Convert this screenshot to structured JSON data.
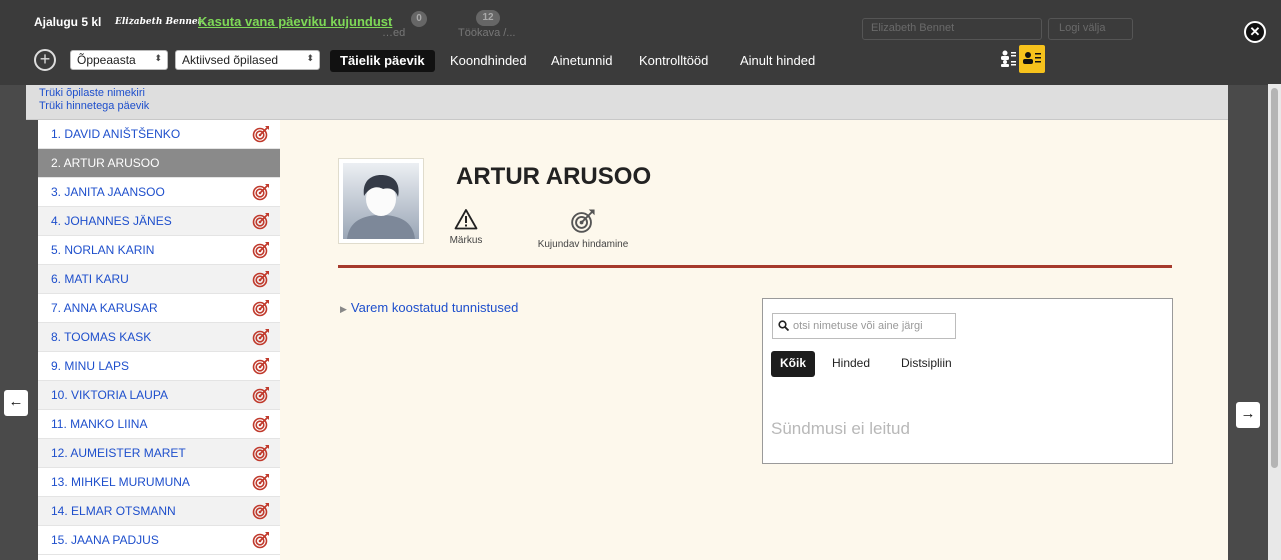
{
  "header": {
    "class_title": "Ajalugu 5 kl",
    "user_signature": "Elizabeth Bennet.",
    "old_layout_link": "Kasuta vana päeviku kujundust"
  },
  "background": {
    "user_name": "Elizabeth Bennet",
    "logout": "Logi välja",
    "badge_a": "0",
    "badge_b": "12",
    "ghost_a": "…ed",
    "ghost_b": "Töökava /..."
  },
  "toolbar": {
    "year_select": "Õppeaasta",
    "students_select": "Aktiivsed õpilased",
    "tabs": [
      {
        "label": "Täielik päevik",
        "active": true
      },
      {
        "label": "Koondhinded"
      },
      {
        "label": "Ainetunnid"
      },
      {
        "label": "Kontrolltööd"
      },
      {
        "label": "Ainult hinded"
      }
    ]
  },
  "print_links": [
    "Trüki õpilaste nimekiri",
    "Trüki hinnetega päevik"
  ],
  "students": [
    "1. DAVID ANIŠTŠENKO",
    "2. ARTUR ARUSOO",
    "3. JANITA JAANSOO",
    "4. JOHANNES JÄNES",
    "5. NORLAN KARIN",
    "6. MATI KARU",
    "7. ANNA KARUSAR",
    "8. TOOMAS KASK",
    "9. MINU LAPS",
    "10. VIKTORIA LAUPA",
    "11. MANKO LIINA",
    "12. AUMEISTER MARET",
    "13. MIHKEL MURUMUNA",
    "14. ELMAR OTSMANN",
    "15. JAANA PADJUS"
  ],
  "selected_student_index": 1,
  "detail": {
    "name": "ARTUR ARUSOO",
    "action_note": "Märkus",
    "action_assess": "Kujundav hindamine",
    "prev_certificates": "Varem koostatud tunnistused"
  },
  "events": {
    "search_placeholder": "otsi nimetuse või aine järgi",
    "filters": [
      "Kõik",
      "Hinded",
      "Distsipliin"
    ],
    "empty": "Sündmusi ei leitud"
  },
  "colors": {
    "link_blue": "#1e4fcc",
    "accent_green": "#7ed957",
    "divider_red": "#a63a2c",
    "panel_bg": "#fdf8ec",
    "active_row": "#8a8a8a"
  },
  "icons": {
    "student_row": "target-dart-icon",
    "note": "warning-triangle-icon",
    "assess": "target-dart-icon",
    "search": "search-icon",
    "nav_prev": "arrow-left-icon",
    "nav_next": "arrow-right-icon",
    "close": "close-icon"
  }
}
